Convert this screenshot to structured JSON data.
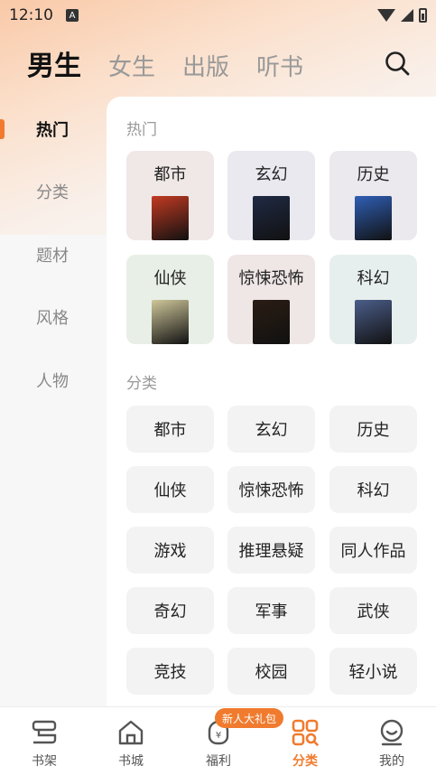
{
  "status_bar": {
    "time": "12:10",
    "notif_letter": "A"
  },
  "top_tabs": [
    {
      "label": "男生",
      "active": true
    },
    {
      "label": "女生",
      "active": false
    },
    {
      "label": "出版",
      "active": false
    },
    {
      "label": "听书",
      "active": false
    }
  ],
  "sidebar": {
    "items": [
      {
        "label": "热门",
        "active": true
      },
      {
        "label": "分类",
        "active": false
      },
      {
        "label": "题材",
        "active": false
      },
      {
        "label": "风格",
        "active": false
      },
      {
        "label": "人物",
        "active": false
      }
    ]
  },
  "hot": {
    "title": "热门",
    "cards": [
      {
        "label": "都市",
        "bg": "#efe8e6",
        "cover": "#c23a22"
      },
      {
        "label": "玄幻",
        "bg": "#e9e9ef",
        "cover": "#1f2a44"
      },
      {
        "label": "历史",
        "bg": "#ebe8ee",
        "cover": "#2f5fb5"
      },
      {
        "label": "仙侠",
        "bg": "#e8efe6",
        "cover": "#cfc79a"
      },
      {
        "label": "惊悚恐怖",
        "bg": "#efe6e6",
        "cover": "#2a1d14"
      },
      {
        "label": "科幻",
        "bg": "#e6efed",
        "cover": "#4b5e8a"
      }
    ]
  },
  "categories": {
    "title": "分类",
    "items": [
      "都市",
      "玄幻",
      "历史",
      "仙侠",
      "惊悚恐怖",
      "科幻",
      "游戏",
      "推理悬疑",
      "同人作品",
      "奇幻",
      "军事",
      "武侠",
      "竞技",
      "校园",
      "轻小说"
    ]
  },
  "bottom_nav": {
    "badge": "新人大礼包",
    "items": [
      {
        "label": "书架",
        "icon": "bookshelf-icon",
        "active": false
      },
      {
        "label": "书城",
        "icon": "home-icon",
        "active": false
      },
      {
        "label": "福利",
        "icon": "gift-bag-icon",
        "active": false
      },
      {
        "label": "分类",
        "icon": "grid-search-icon",
        "active": true
      },
      {
        "label": "我的",
        "icon": "smile-face-icon",
        "active": false
      }
    ]
  },
  "colors": {
    "accent": "#f07b2e",
    "chip_bg": "#f3f3f3"
  }
}
